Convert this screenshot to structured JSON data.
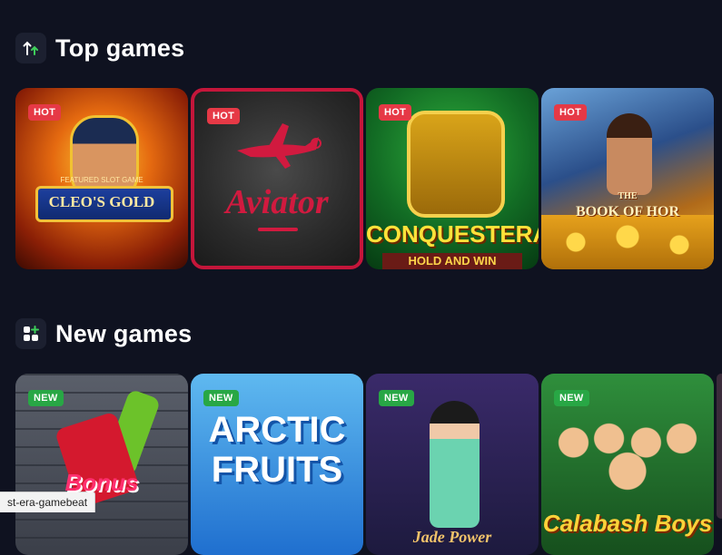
{
  "sections": {
    "top": {
      "title": "Top games",
      "icon": "trending-up-icon",
      "games": [
        {
          "badge": "HOT",
          "title": "CLEO'S GOLD",
          "subtitle": "FEATURED SLOT GAME"
        },
        {
          "badge": "HOT",
          "title": "Aviator"
        },
        {
          "badge": "HOT",
          "title": "CONQUESTERA",
          "subtitle": "HOLD AND WIN"
        },
        {
          "badge": "HOT",
          "title": "BOOK OF HOR",
          "subtitle": "THE"
        }
      ]
    },
    "new": {
      "title": "New games",
      "icon": "grid-plus-icon",
      "games": [
        {
          "badge": "NEW",
          "title": "Bonus"
        },
        {
          "badge": "NEW",
          "title": "ARCTIC FRUITS"
        },
        {
          "badge": "NEW",
          "title": "Jade Power"
        },
        {
          "badge": "NEW",
          "title": "Calabash Boys"
        }
      ]
    }
  },
  "status_bar": {
    "text": "st-era-gamebeat"
  },
  "colors": {
    "background": "#0f1220",
    "hot_badge": "#e63946",
    "new_badge": "#28a745",
    "icon_bg": "#1c2030"
  }
}
